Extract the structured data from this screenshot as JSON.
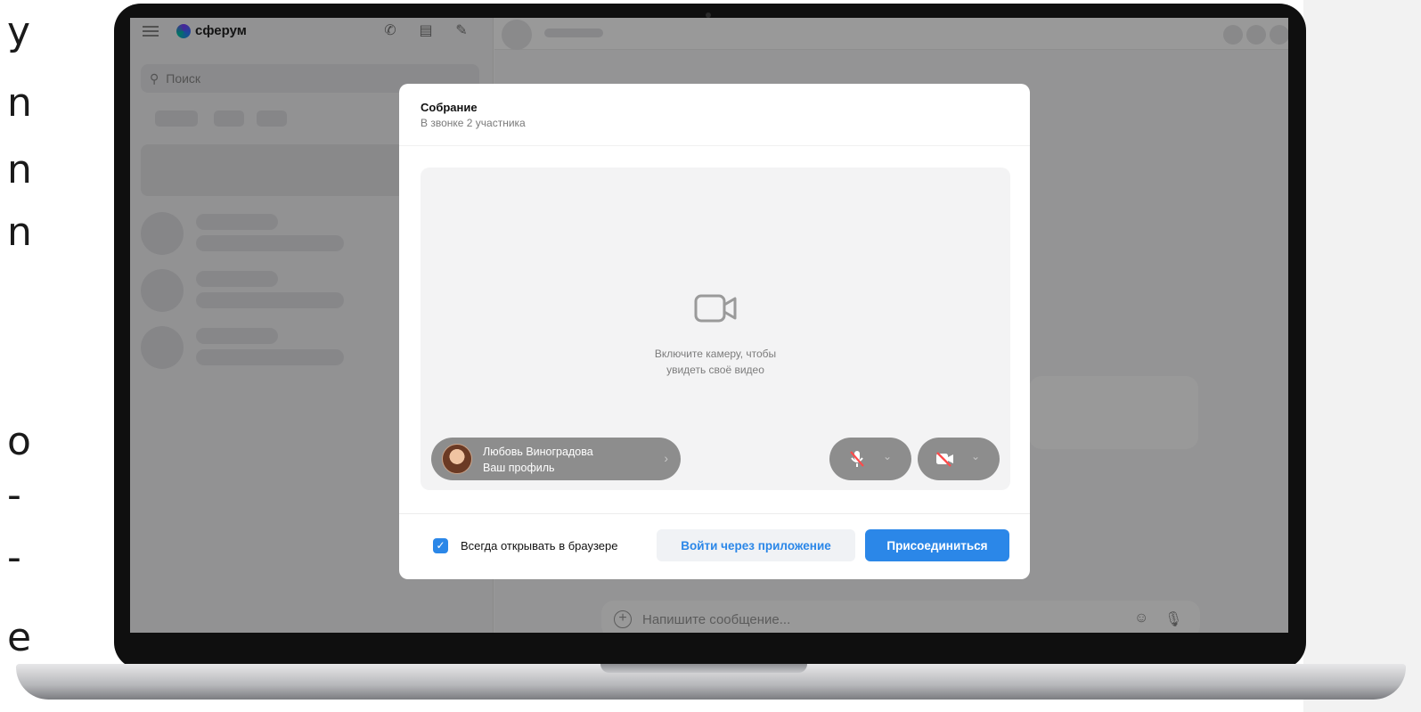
{
  "left_text_fragments": [
    "y",
    "n",
    "n",
    "n",
    "o",
    "-",
    "-",
    "e"
  ],
  "app": {
    "brand": "сферум",
    "search_placeholder": "Поиск",
    "composer_placeholder": "Напишите сообщение..."
  },
  "modal": {
    "title": "Собрание",
    "subtitle": "В звонке 2 участника",
    "preview": {
      "camera_hint_line1": "Включите камеру, чтобы",
      "camera_hint_line2": "увидеть своё видео"
    },
    "profile": {
      "name": "Любовь Виноградова",
      "label": "Ваш профиль"
    },
    "controls": {
      "mic_icon": "mic-off-icon",
      "camera_icon": "camera-off-icon"
    },
    "footer": {
      "checkbox_checked": true,
      "checkbox_label": "Всегда открывать в браузере",
      "secondary_button": "Войти через приложение",
      "primary_button": "Присоединиться"
    }
  },
  "colors": {
    "accent": "#2b87e8",
    "overlay": "rgba(0,0,0,0.40)"
  }
}
